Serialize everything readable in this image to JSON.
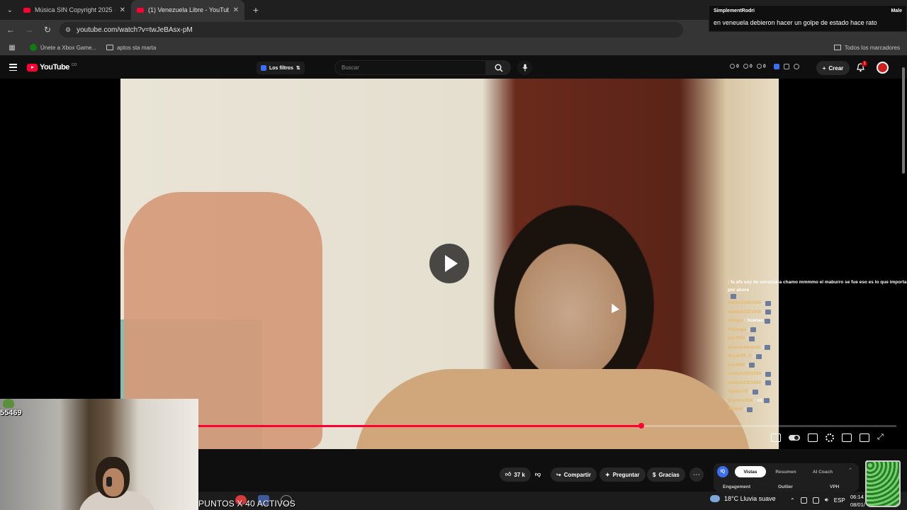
{
  "browser": {
    "tabs": [
      {
        "title": "Música SIN Copyright 2025 🔥",
        "active": false
      },
      {
        "title": "(1) Venezuela Libre - YouTube",
        "active": true
      }
    ],
    "url": "youtube.com/watch?v=twJeBAsx-pM",
    "bookmarks": [
      "Únete a Xbox Game...",
      "aptos sta marta"
    ],
    "all_bookmarks": "Todos los marcadores"
  },
  "notification": {
    "user": "SimplementRodri",
    "right_user": "Male",
    "message": "en veneuela debieron hacer un golpe de estado hace rato"
  },
  "youtube": {
    "logo": "YouTube",
    "logo_suffix": "CO",
    "filters": "Los filtros",
    "search_placeholder": "Buscar",
    "stats": [
      "0",
      "0",
      "0"
    ],
    "create": "Crear",
    "notif_count": "1"
  },
  "chat": [
    {
      "user": "",
      "text": ": fa afs soy de venezuela chamo mmmmo el maburro se fue eso es lo que importa por ahora"
    },
    {
      "user": "",
      "text": ""
    },
    {
      "user": "mattoGOD1956",
      "text": ":"
    },
    {
      "user": "mattoGOD1956",
      "text": ":"
    },
    {
      "user": "cetripo",
      "text": ": buenas"
    },
    {
      "user": "Athanga",
      "text": ":"
    },
    {
      "user": "julyf999",
      "text": ":"
    },
    {
      "user": "alvarocabrera3",
      "text": ":"
    },
    {
      "user": "Bryan98_X",
      "text": ":"
    },
    {
      "user": "julyf999",
      "text": ":"
    },
    {
      "user": "mattoGOD1956",
      "text": ":"
    },
    {
      "user": "mattoGOD1956",
      "text": ":"
    },
    {
      "user": "rapaso15",
      "text": ":"
    },
    {
      "user": "Szymvs456",
      "text": ": xd"
    },
    {
      "user": "Wit6o5",
      "text": ":"
    }
  ],
  "player": {
    "progress": 0.635
  },
  "actions": {
    "likes": "37 k",
    "share": "Compartir",
    "ask": "Preguntar",
    "thanks": "Gracias"
  },
  "panel": {
    "logo": "IQ",
    "tabs": [
      "Vistas",
      "Resumen",
      "AI Coach"
    ],
    "sub": [
      "Engagement",
      "Outlier",
      "VPH"
    ]
  },
  "stream": {
    "viewers": "55469",
    "points_text": "PUNTOS X 40 ACTIVOS"
  },
  "taskbar": {
    "weather": "18°C  Lluvia suave",
    "lang": "ESP",
    "time": "06:14",
    "date": "08/01/"
  },
  "colors": {
    "accent_red": "#ff0033",
    "bg": "#0f0f0f"
  }
}
